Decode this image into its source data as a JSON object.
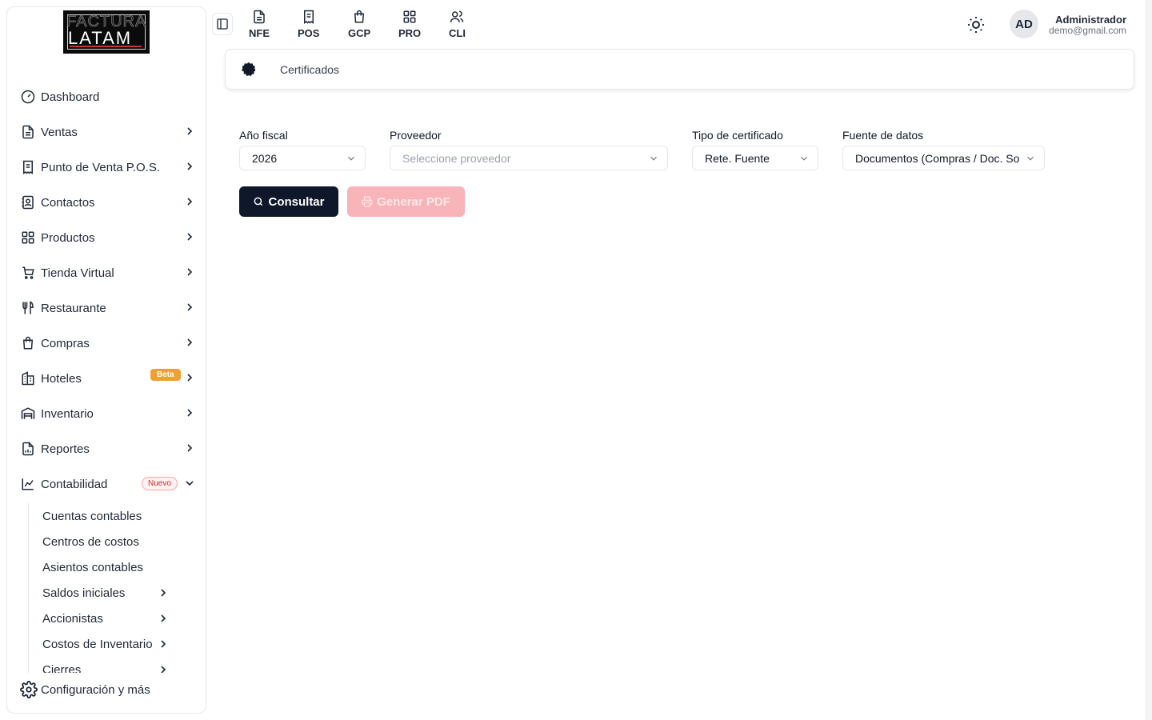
{
  "logo": {
    "line1": "FACTURA",
    "line2": "LATAM"
  },
  "sidebar": {
    "items": [
      {
        "label": "Dashboard"
      },
      {
        "label": "Ventas"
      },
      {
        "label": "Punto de Venta P.O.S."
      },
      {
        "label": "Contactos"
      },
      {
        "label": "Productos"
      },
      {
        "label": "Tienda Virtual"
      },
      {
        "label": "Restaurante"
      },
      {
        "label": "Compras"
      },
      {
        "label": "Hoteles",
        "badge": "Beta"
      },
      {
        "label": "Inventario"
      },
      {
        "label": "Reportes"
      },
      {
        "label": "Contabilidad",
        "badge": "Nuevo"
      }
    ],
    "subitems": [
      {
        "label": "Cuentas contables"
      },
      {
        "label": "Centros de costos"
      },
      {
        "label": "Asientos contables"
      },
      {
        "label": "Saldos iniciales"
      },
      {
        "label": "Accionistas"
      },
      {
        "label": "Costos de Inventario"
      },
      {
        "label": "Cierres"
      }
    ],
    "config_label": "Configuración y más"
  },
  "topbar": {
    "nav": [
      {
        "label": "NFE",
        "icon": "file-text-icon"
      },
      {
        "label": "POS",
        "icon": "receipt-icon"
      },
      {
        "label": "GCP",
        "icon": "shopping-bag-icon"
      },
      {
        "label": "PRO",
        "icon": "grid-icon"
      },
      {
        "label": "CLI",
        "icon": "users-icon"
      }
    ],
    "user": {
      "initials": "AD",
      "name": "Administrador",
      "email": "demo@gmail.com"
    }
  },
  "breadcrumb": {
    "label": "Certificados",
    "icon": "badge-icon"
  },
  "form": {
    "year": {
      "label": "Año fiscal",
      "value": "2026"
    },
    "provider": {
      "label": "Proveedor",
      "placeholder": "Seleccione proveedor"
    },
    "cert_type": {
      "label": "Tipo de certificado",
      "value": "Rete. Fuente"
    },
    "source": {
      "label": "Fuente de datos",
      "value": "Documentos (Compras / Doc. Sop"
    }
  },
  "buttons": {
    "consultar": "Consultar",
    "pdf": "Generar PDF"
  },
  "colors": {
    "primary": "#0f172a",
    "pdf_disabled": "#f8b4b8",
    "beta": "#f0a030",
    "nuevo": "#dc2626"
  }
}
